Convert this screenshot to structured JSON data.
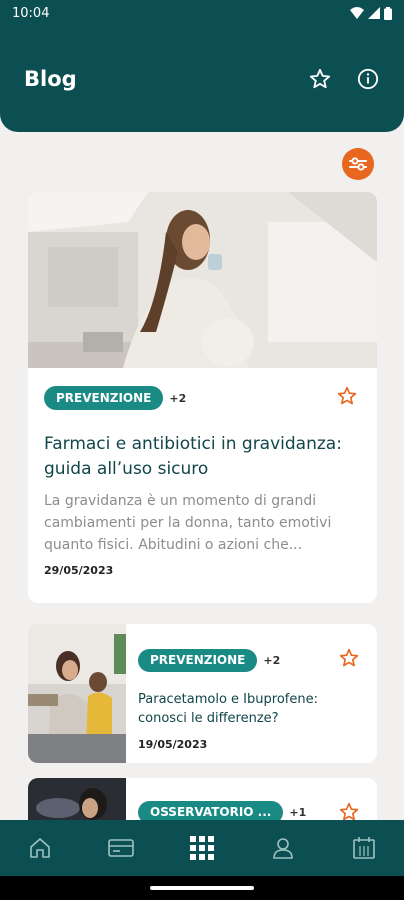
{
  "status_bar": {
    "time": "10:04"
  },
  "header": {
    "title": "Blog"
  },
  "articles": [
    {
      "tag": "PREVENZIONE",
      "extra_tags": "+2",
      "title": "Farmaci e antibiotici in gravidanza: guida all’uso sicuro",
      "excerpt": "La gravidanza è un momento di grandi cambiamenti per la donna, tanto emotivi quanto fisici. Abitudini o azioni che...",
      "date": "29/05/2023"
    },
    {
      "tag": "PREVENZIONE",
      "extra_tags": "+2",
      "title": "Paracetamolo e Ibuprofene: conosci le differenze?",
      "date": "19/05/2023"
    },
    {
      "tag": "OSSERVATORIO ...",
      "extra_tags": "+1"
    }
  ],
  "colors": {
    "primary": "#0c4f52",
    "accent": "#e8661e",
    "tag": "#1a8a85"
  },
  "bottom_nav": [
    "home-icon",
    "card-icon",
    "grid-icon",
    "user-icon",
    "calendar-icon"
  ]
}
